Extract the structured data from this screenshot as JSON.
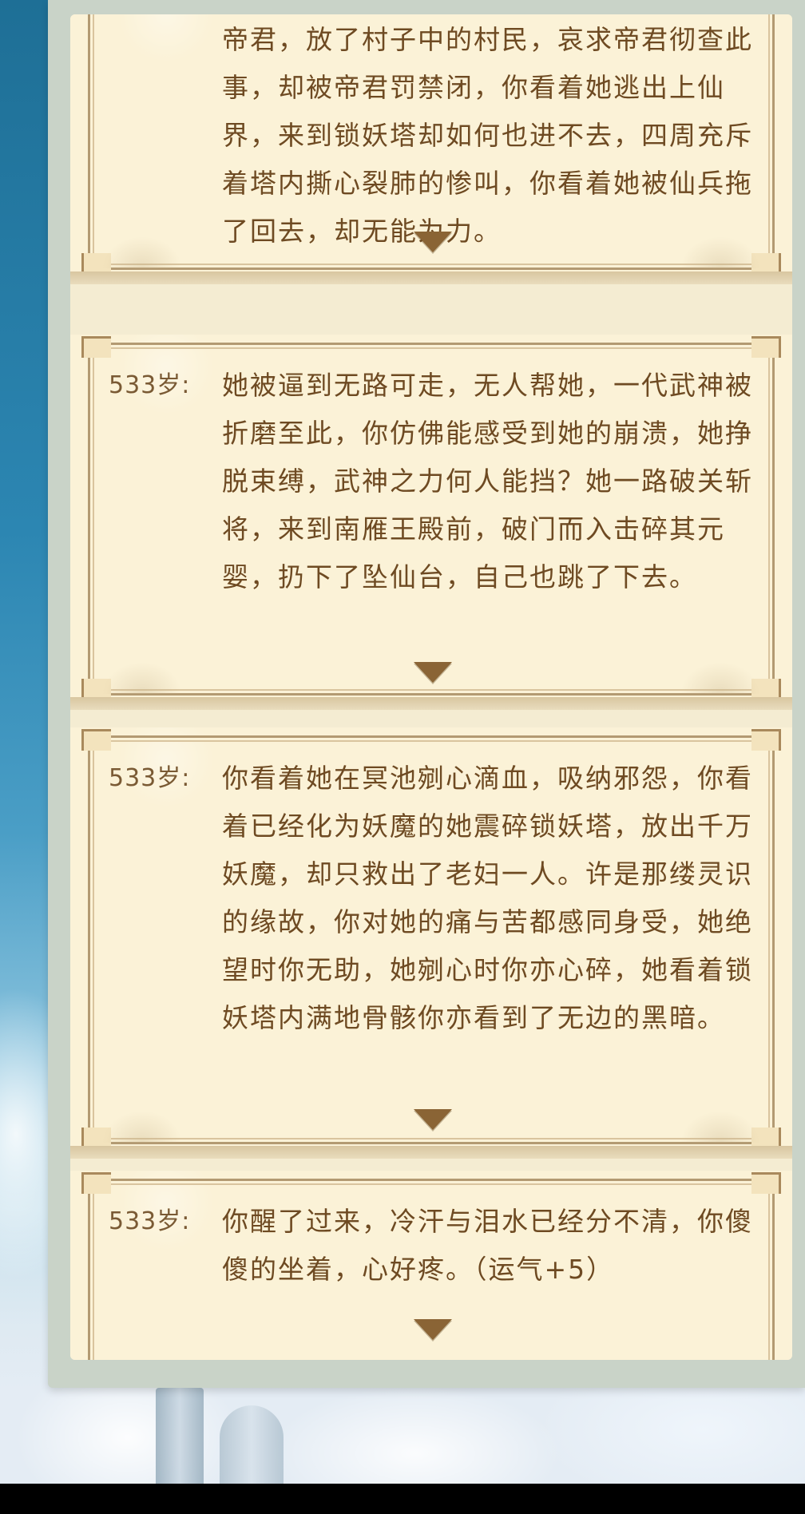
{
  "entries": [
    {
      "age": "",
      "text": "帝君，放了村子中的村民，哀求帝君彻查此事，却被帝君罚禁闭，你看着她逃出上仙界，来到锁妖塔却如何也进不去，四周充斥着塔内撕心裂肺的惨叫，你看着她被仙兵拖了回去，却无能为力。"
    },
    {
      "age": "533岁:",
      "text": "她被逼到无路可走，无人帮她，一代武神被折磨至此，你仿佛能感受到她的崩溃，她挣脱束缚，武神之力何人能挡？她一路破关斩将，来到南雁王殿前，破门而入击碎其元婴，扔下了坠仙台，自己也跳了下去。"
    },
    {
      "age": "533岁:",
      "text": "你看着她在冥池剜心滴血，吸纳邪怨，你看着已经化为妖魔的她震碎锁妖塔，放出千万妖魔，却只救出了老妇一人。许是那缕灵识的缘故，你对她的痛与苦都感同身受，她绝望时你无助，她剜心时你亦心碎，她看着锁妖塔内满地骨骸你亦看到了无边的黑暗。"
    },
    {
      "age": "533岁:",
      "text": "你醒了过来，冷汗与泪水已经分不清，你傻傻的坐着，心好疼。（运气+5）"
    }
  ],
  "icons": {
    "expand": "triangle-down-icon"
  },
  "colors": {
    "paper": "#fbf2d7",
    "frame": "#b39a72",
    "text": "#6e4a22",
    "arrow": "#8a6435"
  }
}
